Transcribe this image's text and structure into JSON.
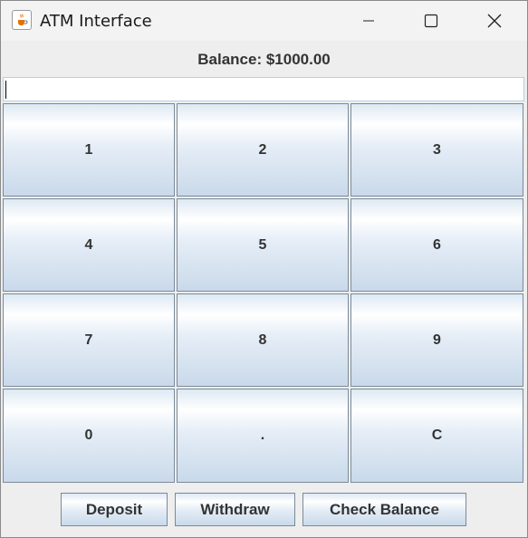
{
  "window": {
    "title": "ATM Interface",
    "icon": "java-cup-icon"
  },
  "balance": {
    "label": "Balance: $1000.00"
  },
  "amount_input": {
    "value": ""
  },
  "keypad": {
    "keys": [
      "1",
      "2",
      "3",
      "4",
      "5",
      "6",
      "7",
      "8",
      "9",
      "0",
      ".",
      "C"
    ]
  },
  "actions": {
    "deposit": "Deposit",
    "withdraw": "Withdraw",
    "check_balance": "Check Balance"
  },
  "colors": {
    "button_gradient_top": "#dde8f3",
    "button_gradient_bottom": "#c9d9ea",
    "button_border": "#7a8a99",
    "window_bg": "#eeeeee"
  }
}
